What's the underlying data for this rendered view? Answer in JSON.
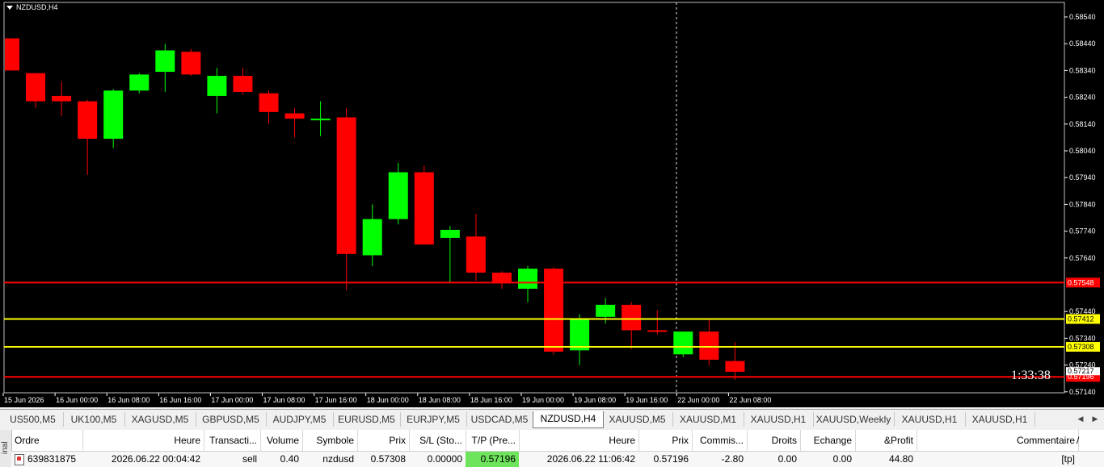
{
  "chart": {
    "symbol_label": "NZDUSD,H4",
    "countdown": "1:33:38",
    "colors": {
      "bull": "#00ff00",
      "bear": "#ff0000",
      "background": "#000000",
      "axis": "#ffffff",
      "line_red": "#ff0000",
      "line_yellow": "#ffff00"
    },
    "price_axis": [
      "0.58540",
      "0.58440",
      "0.58340",
      "0.58240",
      "0.58140",
      "0.58040",
      "0.57940",
      "0.57840",
      "0.57740",
      "0.57640",
      "0.57440",
      "0.57340",
      "0.57240",
      "0.57140"
    ],
    "time_axis": [
      "15 Jun 2026",
      "16 Jun 00:00",
      "16 Jun 08:00",
      "16 Jun 16:00",
      "17 Jun 00:00",
      "17 Jun 08:00",
      "17 Jun 16:00",
      "18 Jun 00:00",
      "18 Jun 08:00",
      "18 Jun 16:00",
      "19 Jun 00:00",
      "19 Jun 08:00",
      "19 Jun 16:00",
      "22 Jun 00:00",
      "22 Jun 08:00"
    ],
    "level_lines": [
      {
        "price": 0.57548,
        "label": "0.57548",
        "color": "red"
      },
      {
        "price": 0.57412,
        "label": "0.57412",
        "color": "yellow"
      },
      {
        "price": 0.57308,
        "label": "0.57308",
        "color": "yellow"
      },
      {
        "price": 0.57196,
        "label": "0.57196",
        "color": "red"
      }
    ],
    "bid_label": "0.57217",
    "candles": [
      {
        "o": 0.5846,
        "h": 0.5846,
        "l": 0.5834,
        "c": 0.5834
      },
      {
        "o": 0.5833,
        "h": 0.5833,
        "l": 0.582,
        "c": 0.58225
      },
      {
        "o": 0.58245,
        "h": 0.583,
        "l": 0.5817,
        "c": 0.58225
      },
      {
        "o": 0.58225,
        "h": 0.5823,
        "l": 0.5795,
        "c": 0.58085
      },
      {
        "o": 0.58085,
        "h": 0.5827,
        "l": 0.5805,
        "c": 0.58265
      },
      {
        "o": 0.58265,
        "h": 0.5833,
        "l": 0.58255,
        "c": 0.58325
      },
      {
        "o": 0.58335,
        "h": 0.5844,
        "l": 0.5826,
        "c": 0.58415
      },
      {
        "o": 0.5841,
        "h": 0.5842,
        "l": 0.5832,
        "c": 0.58325
      },
      {
        "o": 0.58245,
        "h": 0.5835,
        "l": 0.5818,
        "c": 0.5832
      },
      {
        "o": 0.5832,
        "h": 0.5835,
        "l": 0.5825,
        "c": 0.5826
      },
      {
        "o": 0.58255,
        "h": 0.58265,
        "l": 0.5814,
        "c": 0.58185
      },
      {
        "o": 0.5818,
        "h": 0.582,
        "l": 0.5809,
        "c": 0.5816
      },
      {
        "o": 0.5816,
        "h": 0.58225,
        "l": 0.58095,
        "c": 0.5816
      },
      {
        "o": 0.58165,
        "h": 0.582,
        "l": 0.5752,
        "c": 0.57655
      },
      {
        "o": 0.5765,
        "h": 0.5784,
        "l": 0.5761,
        "c": 0.57785
      },
      {
        "o": 0.57785,
        "h": 0.57995,
        "l": 0.57765,
        "c": 0.5796
      },
      {
        "o": 0.5796,
        "h": 0.57985,
        "l": 0.57695,
        "c": 0.5769
      },
      {
        "o": 0.57715,
        "h": 0.5776,
        "l": 0.5755,
        "c": 0.57745
      },
      {
        "o": 0.5772,
        "h": 0.57805,
        "l": 0.57555,
        "c": 0.57585
      },
      {
        "o": 0.57585,
        "h": 0.5759,
        "l": 0.57525,
        "c": 0.57545
      },
      {
        "o": 0.57525,
        "h": 0.5761,
        "l": 0.57475,
        "c": 0.576
      },
      {
        "o": 0.576,
        "h": 0.57605,
        "l": 0.5728,
        "c": 0.5729
      },
      {
        "o": 0.57295,
        "h": 0.5743,
        "l": 0.5724,
        "c": 0.57415
      },
      {
        "o": 0.5742,
        "h": 0.5749,
        "l": 0.57395,
        "c": 0.57465
      },
      {
        "o": 0.57465,
        "h": 0.57475,
        "l": 0.573,
        "c": 0.5737
      },
      {
        "o": 0.5737,
        "h": 0.57445,
        "l": 0.57355,
        "c": 0.57365
      },
      {
        "o": 0.5728,
        "h": 0.57365,
        "l": 0.5727,
        "c": 0.57365
      },
      {
        "o": 0.57365,
        "h": 0.57415,
        "l": 0.5724,
        "c": 0.5726
      },
      {
        "o": 0.57255,
        "h": 0.57325,
        "l": 0.57185,
        "c": 0.57215
      }
    ]
  },
  "tabs": [
    {
      "label": "US500,M5"
    },
    {
      "label": "UK100,M5"
    },
    {
      "label": "XAGUSD,M5"
    },
    {
      "label": "GBPUSD,M5"
    },
    {
      "label": "AUDJPY,M5"
    },
    {
      "label": "EURUSD,M5"
    },
    {
      "label": "EURJPY,M5"
    },
    {
      "label": "USDCAD,M5"
    },
    {
      "label": "NZDUSD,H4",
      "active": true
    },
    {
      "label": "XAUUSD,M5"
    },
    {
      "label": "XAUUSD,M1"
    },
    {
      "label": "XAUUSD,H1"
    },
    {
      "label": "XAUUSD,Weekly"
    },
    {
      "label": "XAUUSD,H1"
    },
    {
      "label": "XAUUSD,H1"
    }
  ],
  "terminal": {
    "side_label": "inal",
    "headers": [
      "Ordre",
      "Heure",
      "Transacti...",
      "Volume",
      "Symbole",
      "Prix",
      "S/L (Sto...",
      "T/P (Pre...",
      "Heure",
      "Prix",
      "Commis...",
      "Droits",
      "Echange",
      "&Profit",
      "Commentaire"
    ],
    "sort_arrow": "/",
    "row": {
      "ordre": "639831875",
      "heure": "2026.06.22 00:04:42",
      "type": "sell",
      "volume": "0.40",
      "symbole": "nzdusd",
      "prix": "0.57308",
      "sl": "0.00000",
      "tp": "0.57196",
      "heure2": "2026.06.22 11:06:42",
      "prix2": "0.57196",
      "commission": "-2.80",
      "droits": "0.00",
      "echange": "0.00",
      "profit": "44.80",
      "commentaire": "[tp]"
    }
  }
}
